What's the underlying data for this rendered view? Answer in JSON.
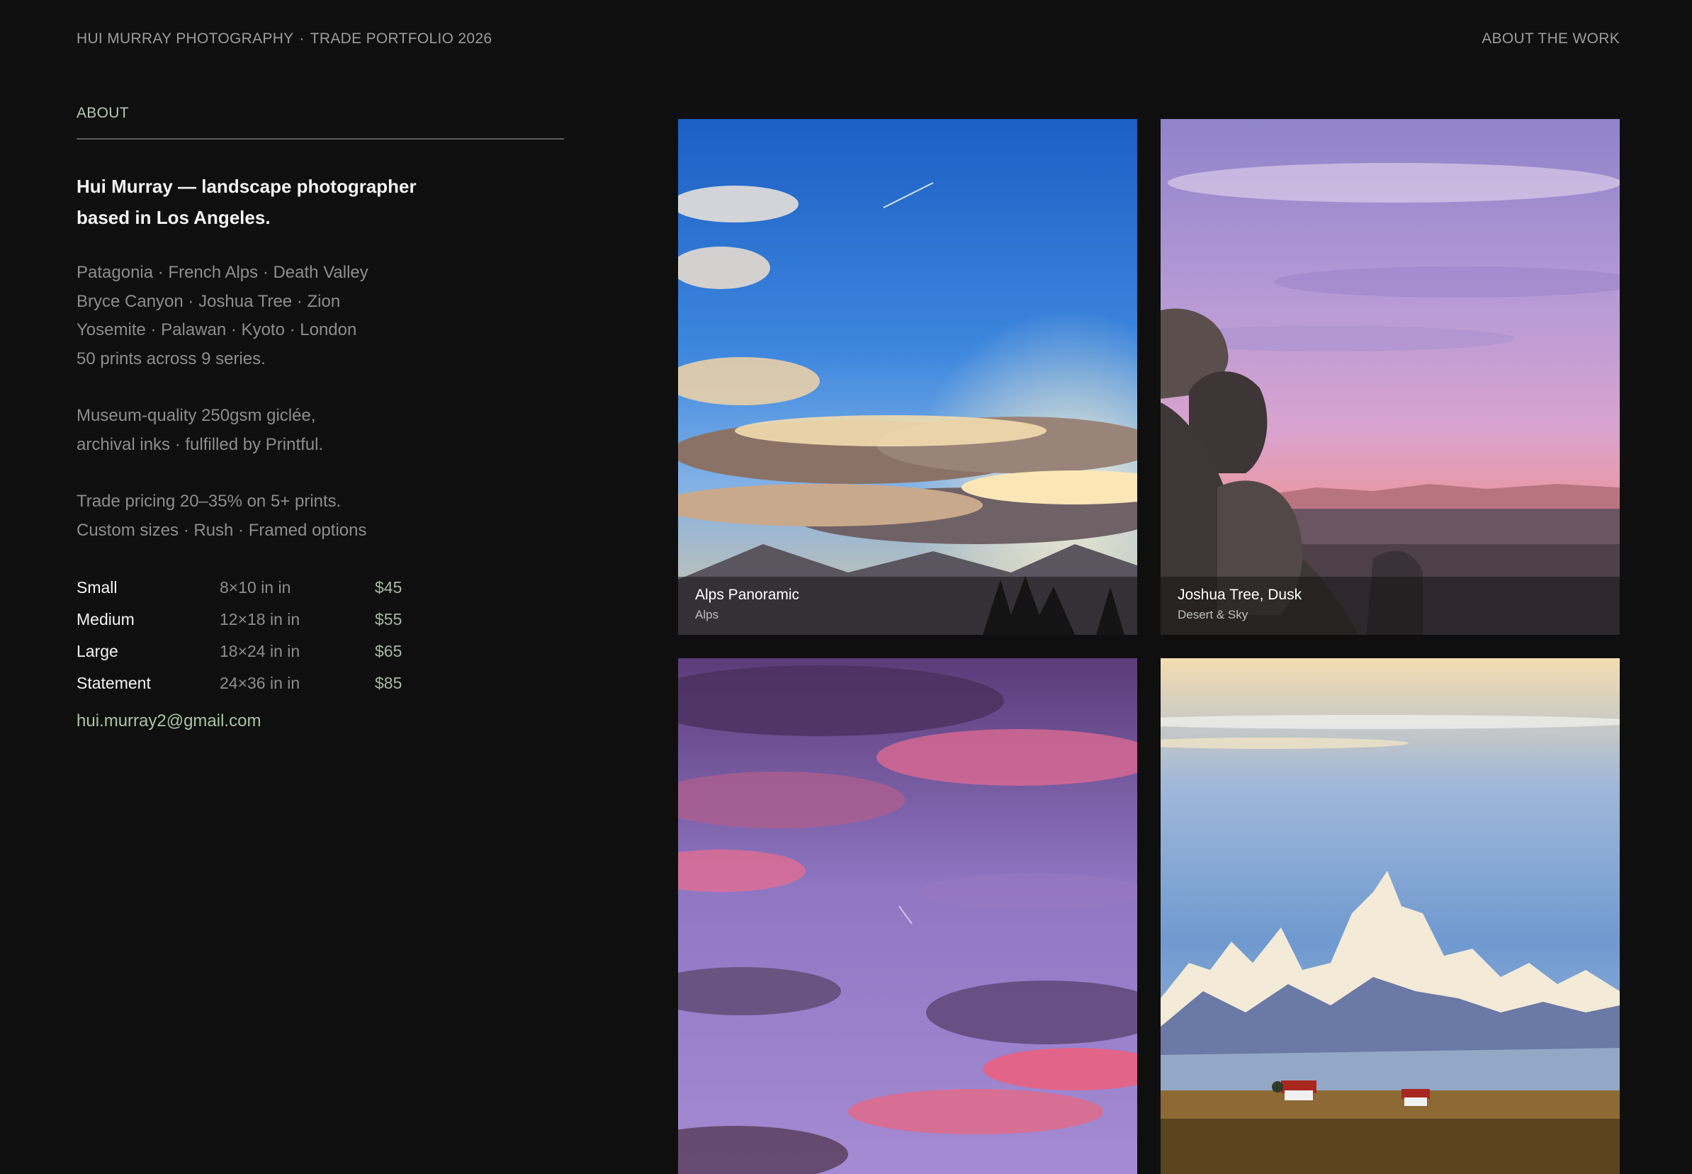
{
  "header": {
    "brand": "HUI MURRAY PHOTOGRAPHY",
    "separator": "·",
    "portfolio": "TRADE PORTFOLIO 2026",
    "nav_about": "ABOUT THE WORK"
  },
  "about": {
    "label": "ABOUT",
    "headline": "Hui Murray — landscape photographer based in Los Angeles.",
    "locations": [
      "Patagonia · French Alps · Death Valley",
      "Bryce Canyon · Joshua Tree · Zion",
      "Yosemite · Palawan · Kyoto · London",
      "50 prints across 9 series."
    ],
    "materials": [
      "Museum-quality 250gsm giclée,",
      "archival inks · fulfilled by Printful."
    ],
    "trade": [
      "Trade pricing 20–35% on 5+ prints.",
      "Custom sizes · Rush · Framed options"
    ],
    "prices": [
      {
        "name": "Small",
        "size": "8×10 in in",
        "price": "$45"
      },
      {
        "name": "Medium",
        "size": "12×18 in in",
        "price": "$55"
      },
      {
        "name": "Large",
        "size": "18×24 in in",
        "price": "$65"
      },
      {
        "name": "Statement",
        "size": "24×36 in in",
        "price": "$85"
      }
    ],
    "email": "hui.murray2@gmail.com"
  },
  "gallery": [
    {
      "title": "Alps Panoramic",
      "series": "Alps"
    },
    {
      "title": "Joshua Tree, Dusk",
      "series": "Desert & Sky"
    },
    {
      "title": "",
      "series": ""
    },
    {
      "title": "",
      "series": ""
    }
  ],
  "colors": {
    "background": "#0f0f0f",
    "accent": "#a9c5a3"
  }
}
